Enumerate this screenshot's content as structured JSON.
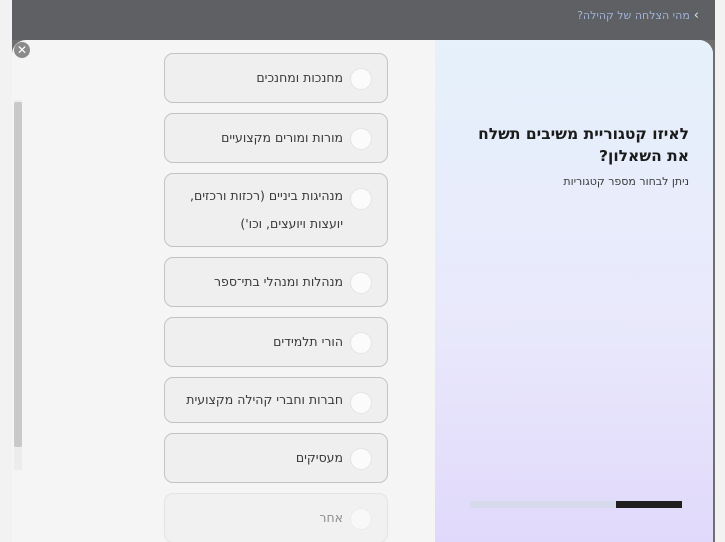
{
  "breadcrumb": {
    "text": "מהי הצלחה של קהילה?",
    "icon": "chevron-right-icon"
  },
  "modal": {
    "close_icon": "close-icon",
    "question": {
      "title": "לאיזו קטגוריית משיבים תשלח את השאלון?",
      "subtitle": "ניתן לבחור מספר קטגוריות"
    },
    "progress": {
      "fraction": 0.31
    },
    "options": [
      {
        "label": "מחנכות ומחנכים",
        "lines": 1
      },
      {
        "label": "מורות ומורים מקצועיים",
        "lines": 1
      },
      {
        "label": "מנהיגות ביניים (רכזות ורכזים, יועצות ויועצים, וכו')",
        "lines": 2
      },
      {
        "label": "מנהלות ומנהלי בתי־ספר",
        "lines": 1
      },
      {
        "label": "הורי תלמידים",
        "lines": 1
      },
      {
        "label": "חברות וחברי קהילה מקצועית",
        "lines": 2
      },
      {
        "label": "מעסיקים",
        "lines": 1
      },
      {
        "label": "אחר",
        "lines": 1
      }
    ]
  }
}
